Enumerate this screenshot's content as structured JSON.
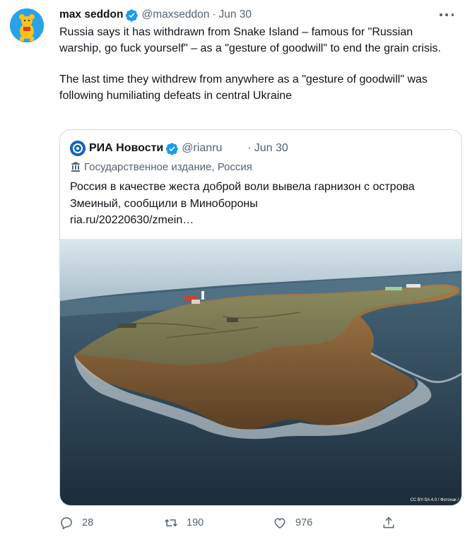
{
  "tweet": {
    "author_name": "max seddon",
    "handle": "@maxseddon",
    "separator": "·",
    "date": "Jun 30",
    "paragraphs": [
      "Russia says it has withdrawn from Snake Island – famous for \"Russian warship, go fuck yourself\" – as a \"gesture of goodwill\" to end the grain crisis.",
      "The last time they withdrew from anywhere as a \"gesture of goodwill\" was following humiliating defeats in central Ukraine"
    ]
  },
  "quoted": {
    "author_name": "РИА Новости",
    "handle": "@rianru",
    "separator": "·",
    "date": "Jun 30",
    "label": "Государственное издание, Россия",
    "text": "Россия в качестве жеста доброй воли вывела гарнизон с острова Змеиный, сообщили в Минобороны",
    "link": "ria.ru/20220630/zmein…",
    "image_credit": "CC BY-SA 4.0 / Фотохак /"
  },
  "actions": {
    "reply_count": "28",
    "retweet_count": "190",
    "like_count": "976"
  },
  "icons": {
    "verified": "verified-badge-icon",
    "more": "more-options-icon",
    "government": "government-building-icon",
    "reply": "reply-icon",
    "retweet": "retweet-icon",
    "like": "heart-icon",
    "share": "share-icon"
  },
  "colors": {
    "verified_blue": "#1d9bf0",
    "secondary_text": "#536471",
    "primary_text": "#0f1419",
    "border": "#cfd9de"
  }
}
